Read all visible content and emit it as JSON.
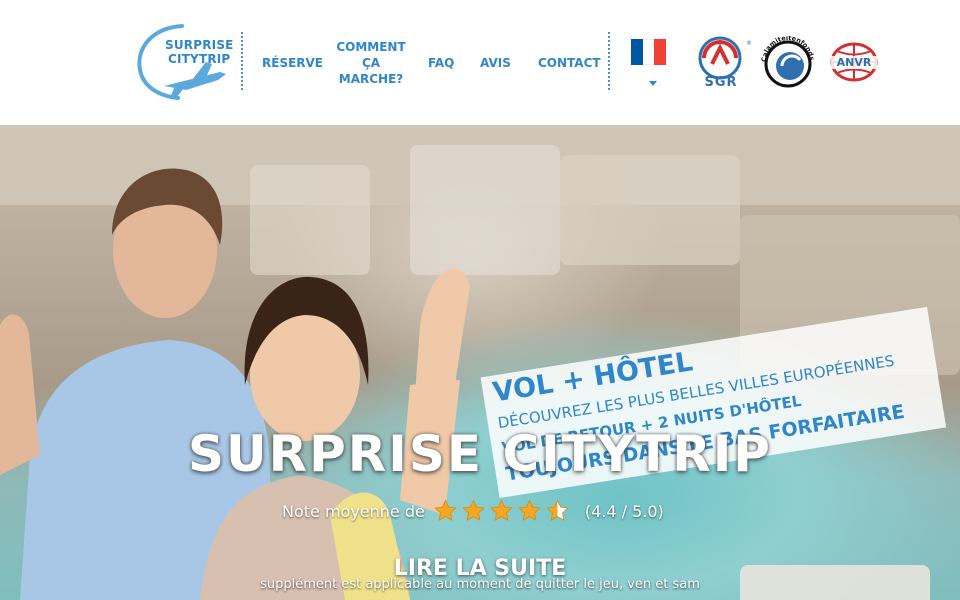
{
  "logo": {
    "line1": "SURPRISE",
    "line2": "CITYTRIP"
  },
  "nav": {
    "reserve": "RÉSERVE",
    "how_line1": "COMMENT",
    "how_line2": "ÇA",
    "how_line3": "MARCHE?",
    "faq": "FAQ",
    "reviews": "AVIS",
    "contact": "CONTACT"
  },
  "language": {
    "selected": "fr",
    "colors": [
      "#0055a4",
      "#ffffff",
      "#ef4135"
    ]
  },
  "badges": {
    "sgr": "SGR",
    "calamiteitenfonds": "Calamiteitenfonds",
    "anvr": "ANVR"
  },
  "banner": {
    "line1": "VOL + HÔTEL",
    "line2": "DÉCOUVREZ LES PLUS BELLES VILLES EUROPÉENNES",
    "line3": "VOL DE RETOUR + 2 NUITS D'HÔTEL",
    "line4": "TOUJOURS DANS LE BAS FORFAITAIRE"
  },
  "hero": {
    "title": "SURPRISE CITYTRIP",
    "rating_prefix": "Note moyenne de",
    "rating_value": 4.4,
    "rating_text": "(4.4 / 5.0)",
    "read_more": "LIRE LA SUITE",
    "footnote": "supplément est applicable au moment de quitter le jeu, ven et sam"
  },
  "colors": {
    "brand": "#2f86c8",
    "star": "#f5a623"
  }
}
